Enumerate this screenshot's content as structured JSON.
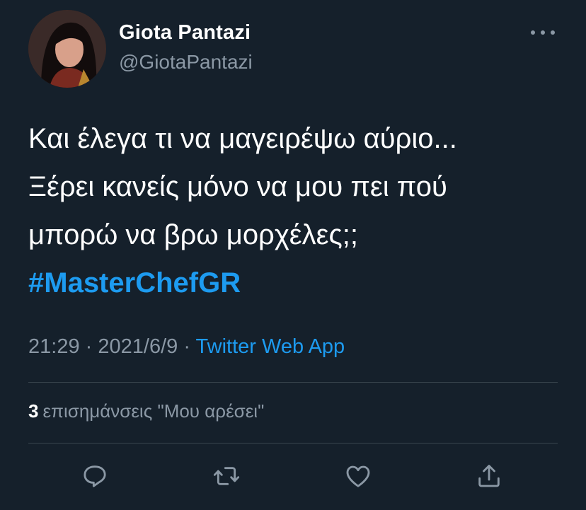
{
  "user": {
    "display_name": "Giota Pantazi",
    "handle": "@GiotaPantazi"
  },
  "tweet": {
    "lines": [
      "Και έλεγα τι να μαγειρέψω αύριο...",
      "Ξέρει κανείς μόνο να μου πει πού",
      "μπορώ να βρω μορχέλες;;"
    ],
    "hashtag": "#MasterChefGR"
  },
  "meta": {
    "time": "21:29",
    "separator": "·",
    "date": "2021/6/9",
    "source": "Twitter Web App"
  },
  "engagement": {
    "likes_count": "3",
    "likes_label": "επισημάνσεις \"Μου αρέσει\""
  },
  "icons": {
    "more": "more-options-icon",
    "reply": "reply-icon",
    "retweet": "retweet-icon",
    "like": "like-icon",
    "share": "share-icon"
  },
  "colors": {
    "background": "#15202b",
    "accent": "#1d9bf0",
    "secondary_text": "#8b98a5",
    "divider": "#38444d"
  }
}
